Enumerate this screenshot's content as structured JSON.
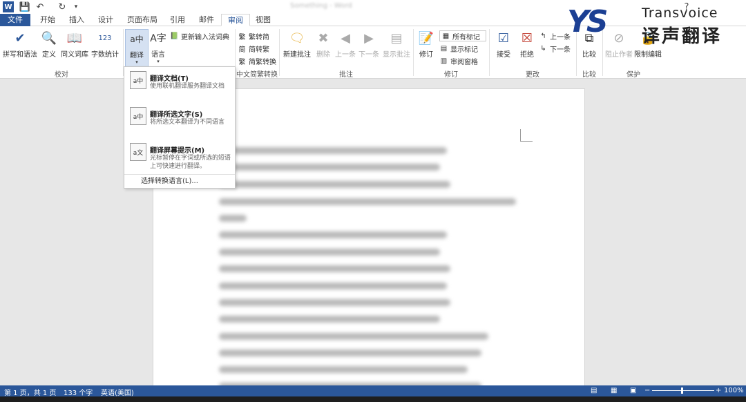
{
  "titlebar": {
    "app_logo": "W",
    "doc_title": "Something - Word",
    "help": "?"
  },
  "tabs": [
    "文件",
    "开始",
    "插入",
    "设计",
    "页面布局",
    "引用",
    "邮件",
    "审阅",
    "视图"
  ],
  "ribbon": {
    "spelling": "拼写和语法",
    "define": "定义",
    "thesaurus": "同义词库",
    "wordcount": "字数统计",
    "translate": "翻译",
    "language": "语言",
    "update_ime": "更新输入法词典",
    "to_trad": "繁转简",
    "to_simp": "简转繁",
    "convert": "简繁转换",
    "new_comment": "新建批注",
    "delete": "删除",
    "prev": "上一条",
    "next": "下一条",
    "show_comments": "显示批注",
    "track": "修订",
    "all_markup": "所有标记",
    "show_markup": "显示标记",
    "review_pane": "审阅窗格",
    "accept": "接受",
    "reject": "拒绝",
    "prev_change": "上一条",
    "next_change": "下一条",
    "compare": "比较",
    "block_authors": "阻止作者",
    "restrict": "限制编辑"
  },
  "groups": {
    "proofing": "校对",
    "chinese_conv": "中文简繁转换",
    "comments": "批注",
    "tracking": "修订",
    "changes": "更改",
    "compare": "比较",
    "protect": "保护"
  },
  "menu": {
    "items": [
      {
        "title": "翻译文档(T)",
        "desc": "使用联机翻译服务翻译文档"
      },
      {
        "title": "翻译所选文字(S)",
        "desc": "将所选文本翻译为不同语言"
      },
      {
        "title": "翻译屏幕提示(M)",
        "desc": "光标暂停在字词或所选的短语上可快速进行翻译。"
      }
    ],
    "footer": "选择转换语言(L)..."
  },
  "status": {
    "page": "第 1 页，共 1 页",
    "words": "133 个字",
    "lang": "英语(美国)",
    "zoom": "100%"
  },
  "brand": {
    "logo": "YS",
    "en": "Transvoice",
    "cn": "译声翻译"
  },
  "colors": {
    "accent": "#2b579a",
    "brand": "#1b3f93"
  }
}
